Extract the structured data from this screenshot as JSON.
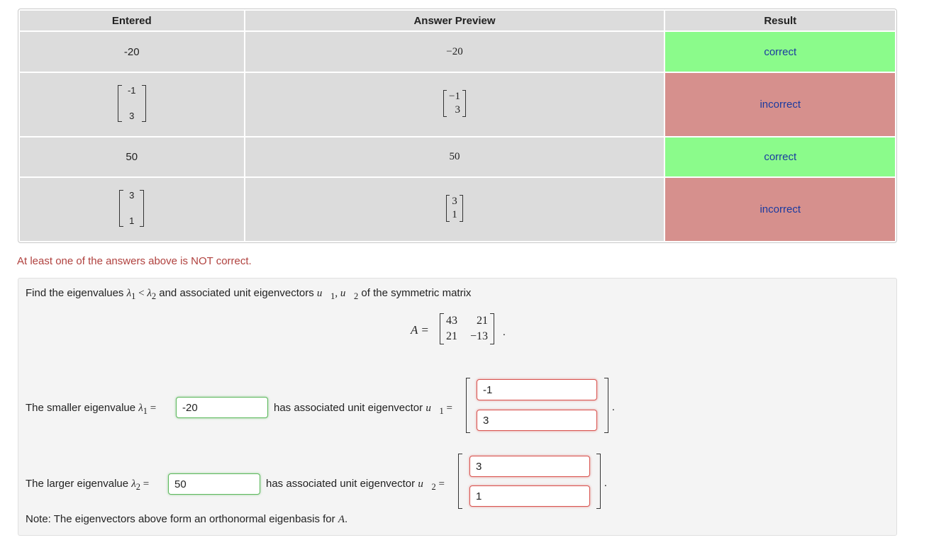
{
  "table": {
    "headers": [
      "Entered",
      "Answer Preview",
      "Result"
    ],
    "rows": [
      {
        "entered": "-20",
        "preview": "−20",
        "result": "correct",
        "status": "correct"
      },
      {
        "entered": [
          "-1",
          "3"
        ],
        "preview": [
          "−1",
          "3"
        ],
        "result": "incorrect",
        "status": "incorrect"
      },
      {
        "entered": "50",
        "preview": "50",
        "result": "correct",
        "status": "correct"
      },
      {
        "entered": [
          "3",
          "1"
        ],
        "preview": [
          "3",
          "1"
        ],
        "result": "incorrect",
        "status": "incorrect"
      }
    ]
  },
  "warning": "At least one of the answers above is NOT correct.",
  "problem": {
    "intro_pre": "Find the eigenvalues ",
    "intro_l1": "λ",
    "intro_sub1": "1",
    "intro_lt": " < ",
    "intro_l2": "λ",
    "intro_sub2": "2",
    "intro_mid": " and associated unit eigenvectors ",
    "intro_u1": "u⃗",
    "intro_u1sub": "1",
    "intro_comma": ", ",
    "intro_u2": "u⃗",
    "intro_u2sub": "2",
    "intro_post": " of the symmetric matrix",
    "matrix_label": "A =",
    "matrix": [
      "43",
      "21",
      "21",
      "−13"
    ],
    "matrix_end": ".",
    "smaller_label": "The smaller eigenvalue ",
    "lambda": "λ",
    "sub1": "1",
    "sub2": "2",
    "equals": " =",
    "smaller_value": "-20",
    "assoc_label": "has associated unit eigenvector ",
    "u": "u⃗",
    "u1_values": [
      "-1",
      "3"
    ],
    "larger_label": "The larger eigenvalue ",
    "larger_value": "50",
    "u2_values": [
      "3",
      "1"
    ],
    "period": ".",
    "note_pre": "Note: The eigenvectors above form an orthonormal eigenbasis for ",
    "note_A": "A",
    "note_post": "."
  },
  "colors": {
    "correct_bg": "#8bfb8b",
    "incorrect_bg": "#d6908d",
    "warning_text": "#b0413e",
    "result_text": "#1a3aa0"
  }
}
